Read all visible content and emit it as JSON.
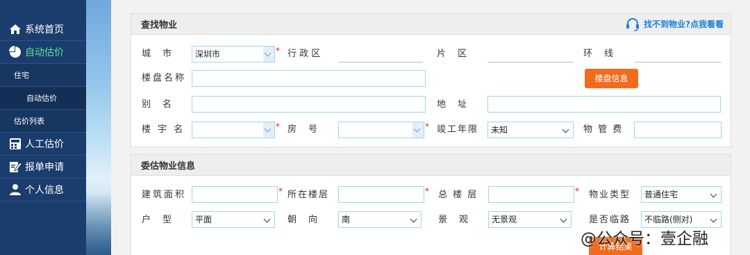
{
  "sidebar": {
    "items": [
      {
        "label": "系统首页",
        "icon": "home-icon"
      },
      {
        "label": "自动估价",
        "icon": "pie-chart-icon"
      },
      {
        "label": "住宅"
      },
      {
        "label": "自动估价"
      },
      {
        "label": "估价列表"
      },
      {
        "label": "人工估价",
        "icon": "calculator-icon"
      },
      {
        "label": "报单申请",
        "icon": "edit-icon"
      },
      {
        "label": "个人信息",
        "icon": "user-icon"
      }
    ]
  },
  "search_panel": {
    "title": "查找物业",
    "help_link": "找不到物业?点我看看",
    "city_label": "城　市",
    "city_value": "深圳市",
    "district_label": "行 政 区",
    "area_label": "片　区",
    "ring_label": "环　线",
    "estate_label": "楼盘名称",
    "estate_button": "楼盘信息",
    "alias_label": "别　名",
    "address_label": "地　址",
    "building_label": "楼 宇 名",
    "room_label": "房　号",
    "year_label": "竣工年限",
    "year_value": "未知",
    "fee_label": "物 管 费"
  },
  "property_panel": {
    "title": "委估物业信息",
    "area_label": "建筑面积",
    "floor_label": "所在楼层",
    "total_floor_label": "总 楼 层",
    "type_label": "物业类型",
    "type_value": "普通住宅",
    "layout_label": "户　型",
    "layout_value": "平面",
    "orient_label": "朝　向",
    "orient_value": "南",
    "view_label": "景　观",
    "view_value": "无景观",
    "road_label": "是否临路",
    "road_value": "不临路(侧对)",
    "calc_button": "计算结果"
  },
  "star": "*",
  "watermark": "@公众号：壹企融"
}
